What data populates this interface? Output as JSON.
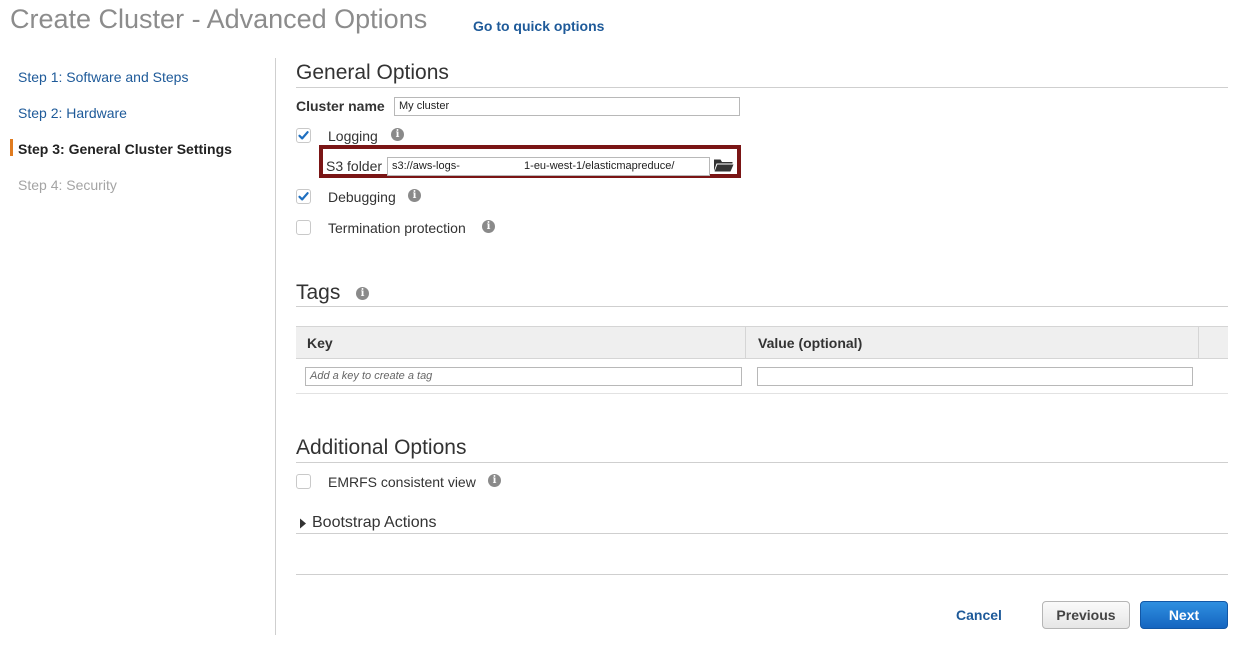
{
  "page_title": "Create Cluster - Advanced Options",
  "quick_options_link": "Go to quick options",
  "sidebar": {
    "steps": [
      {
        "label": "Step 1: Software and Steps",
        "state": "link"
      },
      {
        "label": "Step 2: Hardware",
        "state": "link"
      },
      {
        "label": "Step 3: General Cluster Settings",
        "state": "active"
      },
      {
        "label": "Step 4: Security",
        "state": "disabled"
      }
    ]
  },
  "general_options": {
    "title": "General Options",
    "cluster_name_label": "Cluster name",
    "cluster_name_value": "My cluster",
    "logging_label": "Logging",
    "logging_checked": true,
    "s3_folder_label": "S3 folder",
    "s3_folder_value": "s3://aws-logs-                     1-eu-west-1/elasticmapreduce/",
    "debugging_label": "Debugging",
    "debugging_checked": true,
    "termination_protection_label": "Termination protection",
    "termination_protection_checked": false
  },
  "tags": {
    "title": "Tags",
    "columns": [
      "Key",
      "Value (optional)"
    ],
    "key_placeholder": "Add a key to create a tag",
    "value_value": ""
  },
  "additional_options": {
    "title": "Additional Options",
    "emrfs_label": "EMRFS consistent view",
    "emrfs_checked": false,
    "bootstrap_label": "Bootstrap Actions"
  },
  "footer": {
    "cancel_label": "Cancel",
    "previous_label": "Previous",
    "next_label": "Next"
  },
  "colors": {
    "link": "#1e5a99",
    "active_step_marker": "#e07b1f",
    "highlight_border": "#7a1515",
    "primary_button": "#1a72c9",
    "checkmark": "#1e6fc0"
  },
  "icons": {
    "info": "info-icon",
    "folder": "folder-open-icon",
    "checkbox": "checkmark-icon",
    "expand": "caret-right-icon"
  }
}
